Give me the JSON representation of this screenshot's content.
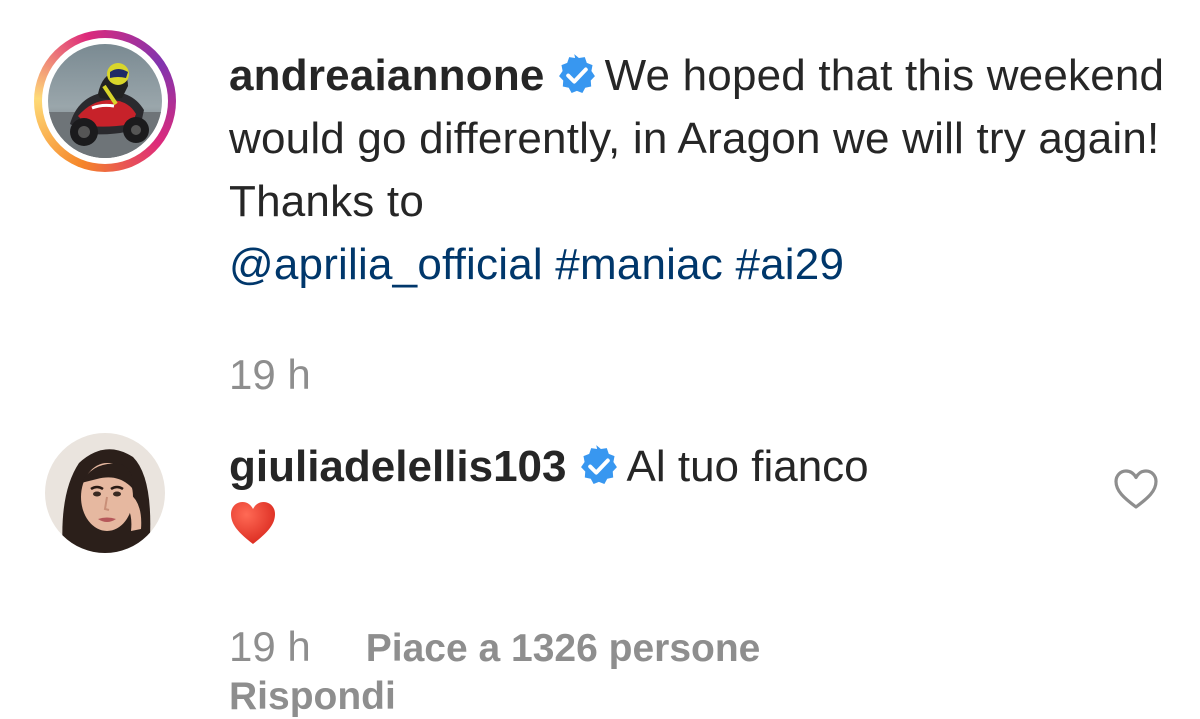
{
  "post": {
    "avatar_icon": "motorbike-rider-photo",
    "username": "andreaiannone",
    "verified_icon": "verified-badge-icon",
    "caption_text": "We hoped that this weekend would go differently, in Aragon we will try again! Thanks to",
    "mention": "@aprilia_official",
    "hashtags": [
      "#maniac",
      "#ai29"
    ],
    "time": "19 h"
  },
  "comment": {
    "avatar_icon": "woman-portrait-photo",
    "username": "giuliadelellis103",
    "verified_icon": "verified-badge-icon",
    "text": "Al tuo fianco",
    "emoji": "red-heart",
    "time": "19 h",
    "likes_label": "Piace a 1326 persone",
    "reply_label": "Rispondi",
    "like_icon": "heart-outline-icon"
  },
  "colors": {
    "link": "#00376b",
    "text": "#262626",
    "muted": "#8e8e8e",
    "verified": "#3897f0",
    "heart": "#e0352b"
  }
}
